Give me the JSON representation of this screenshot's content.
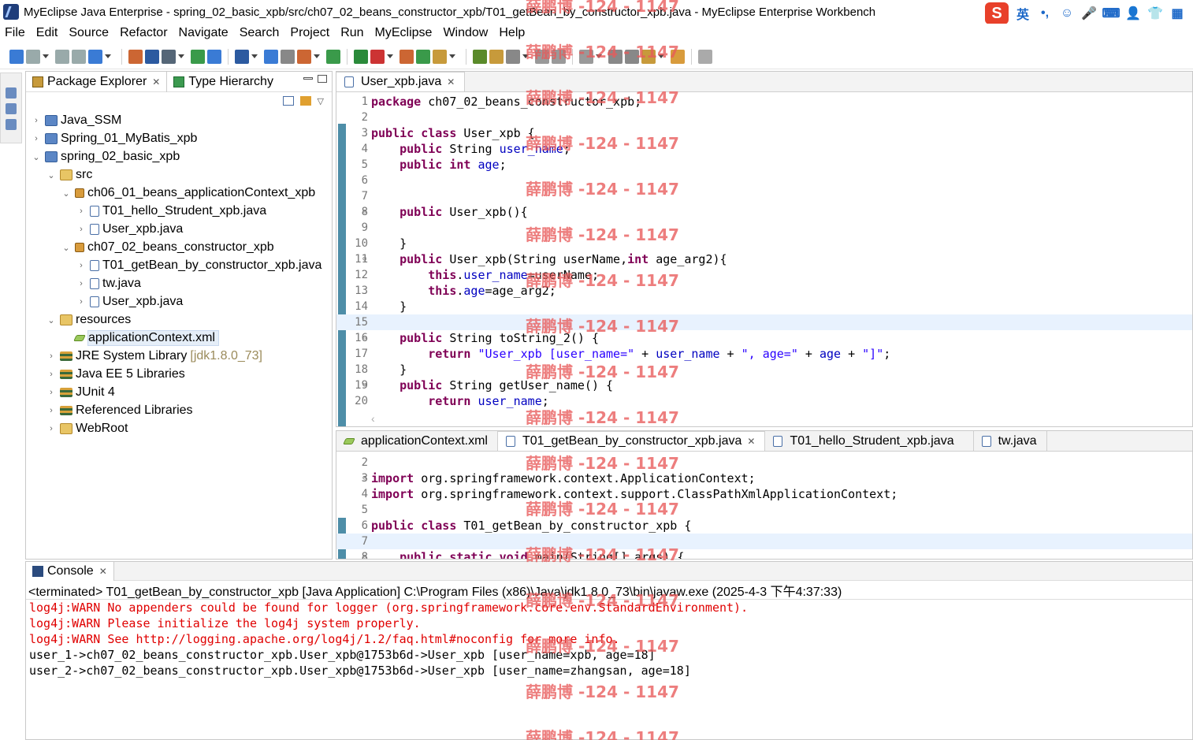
{
  "window": {
    "title": "MyEclipse Java Enterprise - spring_02_basic_xpb/src/ch07_02_beans_constructor_xpb/T01_getBean_by_constructor_xpb.java - MyEclipse Enterprise Workbench"
  },
  "ime": {
    "logo": "S",
    "mode": "英",
    "punct": "•,",
    "smile": "☺",
    "mic": "🎤",
    "keyboard": "⌨",
    "user": "👤",
    "shirt": "👕",
    "grid": "▦"
  },
  "menu": [
    "File",
    "Edit",
    "Source",
    "Refactor",
    "Navigate",
    "Search",
    "Project",
    "Run",
    "MyEclipse",
    "Window",
    "Help"
  ],
  "package_explorer": {
    "tabs": [
      {
        "label": "Package Explorer",
        "active": true
      },
      {
        "label": "Type Hierarchy",
        "active": false
      }
    ],
    "tree": [
      {
        "label": "Java_SSM",
        "icon": "project-icon",
        "expanded": false,
        "depth": 0
      },
      {
        "label": "Spring_01_MyBatis_xpb",
        "icon": "project-icon",
        "expanded": false,
        "depth": 0
      },
      {
        "label": "spring_02_basic_xpb",
        "icon": "project-icon",
        "expanded": true,
        "depth": 0
      },
      {
        "label": "src",
        "icon": "source-folder-icon",
        "expanded": true,
        "depth": 1
      },
      {
        "label": "ch06_01_beans_applicationContext_xpb",
        "icon": "package-icon",
        "expanded": true,
        "depth": 2
      },
      {
        "label": "T01_hello_Strudent_xpb.java",
        "icon": "java-file-icon",
        "expanded": false,
        "depth": 3
      },
      {
        "label": "User_xpb.java",
        "icon": "java-file-icon",
        "expanded": false,
        "depth": 3
      },
      {
        "label": "ch07_02_beans_constructor_xpb",
        "icon": "package-icon",
        "expanded": true,
        "depth": 2
      },
      {
        "label": "T01_getBean_by_constructor_xpb.java",
        "icon": "java-file-icon",
        "expanded": false,
        "depth": 3
      },
      {
        "label": "tw.java",
        "icon": "java-file-icon",
        "expanded": false,
        "depth": 3
      },
      {
        "label": "User_xpb.java",
        "icon": "java-file-icon",
        "expanded": false,
        "depth": 3
      },
      {
        "label": "resources",
        "icon": "source-folder-icon",
        "expanded": true,
        "depth": 1
      },
      {
        "label": "applicationContext.xml",
        "icon": "xml-file-icon",
        "expanded": null,
        "depth": 2,
        "selected": true
      },
      {
        "label": "JRE System Library",
        "suffix": "[jdk1.8.0_73]",
        "icon": "library-icon",
        "expanded": false,
        "depth": 1
      },
      {
        "label": "Java EE 5 Libraries",
        "icon": "library-icon",
        "expanded": false,
        "depth": 1
      },
      {
        "label": "JUnit 4",
        "icon": "library-icon",
        "expanded": false,
        "depth": 1
      },
      {
        "label": "Referenced Libraries",
        "icon": "library-icon",
        "expanded": false,
        "depth": 1
      },
      {
        "label": "WebRoot",
        "icon": "folder-icon",
        "expanded": false,
        "depth": 1
      }
    ]
  },
  "editor_top": {
    "tab": "User_xpb.java",
    "lines": [
      {
        "n": "1",
        "code": "package ch07_02_beans_constructor_xpb;"
      },
      {
        "n": "2",
        "code": ""
      },
      {
        "n": "3",
        "code": "public class User_xpb {"
      },
      {
        "n": "4",
        "code": "    public String user_name;"
      },
      {
        "n": "5",
        "code": "    public int age;"
      },
      {
        "n": "6",
        "code": ""
      },
      {
        "n": "7",
        "code": ""
      },
      {
        "n": "8",
        "code": "    public User_xpb(){",
        "fold": true
      },
      {
        "n": "9",
        "code": ""
      },
      {
        "n": "10",
        "code": "    }"
      },
      {
        "n": "11",
        "code": "    public User_xpb(String userName,int age_arg2){",
        "fold": true
      },
      {
        "n": "12",
        "code": "        this.user_name=userName;"
      },
      {
        "n": "13",
        "code": "        this.age=age_arg2;"
      },
      {
        "n": "14",
        "code": "    }"
      },
      {
        "n": "15",
        "code": "",
        "current": true
      },
      {
        "n": "16",
        "code": "    public String toString_2() {",
        "fold": true
      },
      {
        "n": "17",
        "code": "        return \"User_xpb [user_name=\" + user_name + \", age=\" + age + \"]\";"
      },
      {
        "n": "18",
        "code": "    }"
      },
      {
        "n": "19",
        "code": "    public String getUser_name() {",
        "fold": true
      },
      {
        "n": "20",
        "code": "        return user_name;"
      }
    ]
  },
  "editor_bottom": {
    "tabs": [
      {
        "label": "applicationContext.xml",
        "active": false
      },
      {
        "label": "T01_getBean_by_constructor_xpb.java",
        "active": true
      },
      {
        "label": "T01_hello_Strudent_xpb.java",
        "active": false
      },
      {
        "label": "tw.java",
        "active": false
      }
    ],
    "lines": [
      {
        "n": "2",
        "code": ""
      },
      {
        "n": "3",
        "code": "import org.springframework.context.ApplicationContext;",
        "fold": true
      },
      {
        "n": "4",
        "code": "import org.springframework.context.support.ClassPathXmlApplicationContext;"
      },
      {
        "n": "5",
        "code": ""
      },
      {
        "n": "6",
        "code": "public class T01_getBean_by_constructor_xpb {"
      },
      {
        "n": "7",
        "code": "",
        "current": true
      },
      {
        "n": "8",
        "code": "    public static void main(String[] args) {",
        "fold": true
      }
    ]
  },
  "console": {
    "tab": "Console",
    "status": "<terminated> T01_getBean_by_constructor_xpb [Java Application] C:\\Program Files (x86)\\Java\\jdk1.8.0_73\\bin\\javaw.exe (2025-4-3 下午4:37:33)",
    "lines": [
      {
        "text": "log4j:WARN No appenders could be found for logger (org.springframework.core.env.StandardEnvironment).",
        "level": "warn"
      },
      {
        "text": "log4j:WARN Please initialize the log4j system properly.",
        "level": "warn"
      },
      {
        "text": "log4j:WARN See http://logging.apache.org/log4j/1.2/faq.html#noconfig for more info.",
        "level": "warn"
      },
      {
        "text": "user_1->ch07_02_beans_constructor_xpb.User_xpb@1753b6d->User_xpb [user_name=xpb, age=18]",
        "level": "out"
      },
      {
        "text": "user_2->ch07_02_beans_constructor_xpb.User_xpb@1753b6d->User_xpb [user_name=zhangsan, age=18]",
        "level": "out"
      }
    ]
  },
  "watermark": {
    "text": "薛鹏博 -124 - 1147",
    "color": "#e85a5a"
  }
}
